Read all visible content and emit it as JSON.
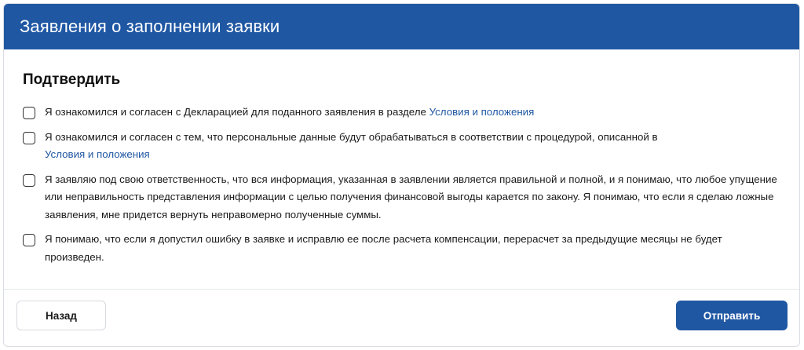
{
  "header": {
    "title": "Заявления о заполнении заявки"
  },
  "section": {
    "title": "Подтвердить",
    "items": [
      {
        "checked": false,
        "text": "Я ознакомился и согласен с Декларацией для поданного заявления в разделе ",
        "link": "Условия и положения",
        "link_on_new_line": false
      },
      {
        "checked": false,
        "text": "Я ознакомился и согласен с тем, что персональные данные будут обрабатываться в соответствии с процедурой, описанной в ",
        "link": "Условия и положения",
        "link_on_new_line": true
      },
      {
        "checked": false,
        "text": "Я заявляю под свою ответственность, что вся информация, указанная в заявлении является правильной и полной, и я понимаю, что любое упущение или неправильность представления информации с целью получения финансовой выгоды карается по закону. Я понимаю, что если я сделаю ложные заявления, мне придется вернуть неправомерно полученные суммы.",
        "link": null
      },
      {
        "checked": false,
        "text": "Я понимаю, что если я допустил ошибку в заявке и исправлю ее после расчета компенсации, перерасчет за предыдущие месяцы не будет произведен.",
        "link": null
      }
    ]
  },
  "footer": {
    "back_label": "Назад",
    "submit_label": "Отправить"
  },
  "colors": {
    "primary": "#1f57a3",
    "link": "#1f57a3"
  }
}
